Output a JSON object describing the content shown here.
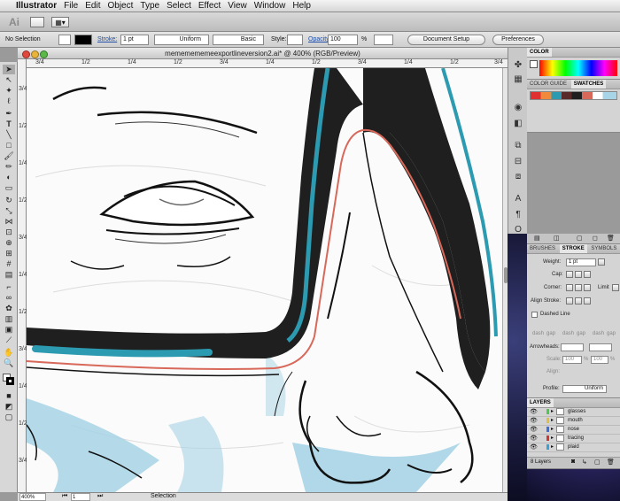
{
  "menubar": {
    "app_name": "Illustrator",
    "items": [
      "File",
      "Edit",
      "Object",
      "Type",
      "Select",
      "Effect",
      "View",
      "Window",
      "Help"
    ]
  },
  "appbar": {
    "logo": "Ai"
  },
  "control_bar": {
    "selection": "No Selection",
    "stroke_label": "Stroke:",
    "stroke_weight": "1 pt",
    "profile": "Uniform",
    "brush": "Basic",
    "style_label": "Style:",
    "opacity_label": "Opacity",
    "opacity_value": "100",
    "opacity_unit": "%",
    "document_setup": "Document Setup",
    "preferences": "Preferences"
  },
  "document": {
    "title": "mememememeexportlineversion2.ai* @ 400% (RGB/Preview)",
    "ruler_h": [
      "3/4",
      "1/2",
      "1/4",
      "1/2",
      "3/4",
      "1/4",
      "1/2",
      "3/4",
      "1/4",
      "1/2",
      "3/4"
    ],
    "ruler_v": [
      "3/4",
      "1/2",
      "1/4",
      "1/2",
      "3/4",
      "1/4",
      "1/2",
      "3/4",
      "1/4",
      "1/2",
      "3/4"
    ]
  },
  "status_bar": {
    "zoom": "400%",
    "page": "1",
    "tool": "Selection"
  },
  "color_panel": {
    "tab": "COLOR"
  },
  "guide_panel": {
    "tabs": [
      "COLOR GUIDE",
      "SWATCHES"
    ]
  },
  "stroke_panel": {
    "tabs": [
      "BRUSHES",
      "STROKE",
      "SYMBOLS"
    ],
    "weight_label": "Weight:",
    "weight_value": "1 pt",
    "cap_label": "Cap:",
    "corner_label": "Corner:",
    "limit_label": "Limit",
    "align_label": "Align Stroke:",
    "dashed_label": "Dashed Line",
    "dash_labels": [
      "dash",
      "gap",
      "dash",
      "gap",
      "dash",
      "gap"
    ],
    "arrowheads_label": "Arrowheads:",
    "scale_label": "Scale:",
    "scale_value1": "100",
    "scale_value2": "100",
    "scale_unit": "%",
    "align_label2": "Align:",
    "profile_label": "Profile:",
    "profile_value": "Uniform"
  },
  "layers_panel": {
    "tab": "LAYERS",
    "layers": [
      {
        "name": "glasses",
        "color": "#4fc850"
      },
      {
        "name": "mouth",
        "color": "#e0c040"
      },
      {
        "name": "nose",
        "color": "#3d6ee0"
      },
      {
        "name": "tracing",
        "color": "#d03434"
      },
      {
        "name": "plaid",
        "color": "#3aa0d8"
      }
    ],
    "count": "8 Layers"
  },
  "colors": {
    "teal": "#2c9ab0",
    "frame": "#1f1f1f",
    "salmon": "#d8685a",
    "lightblue": "#a7d4e6"
  }
}
